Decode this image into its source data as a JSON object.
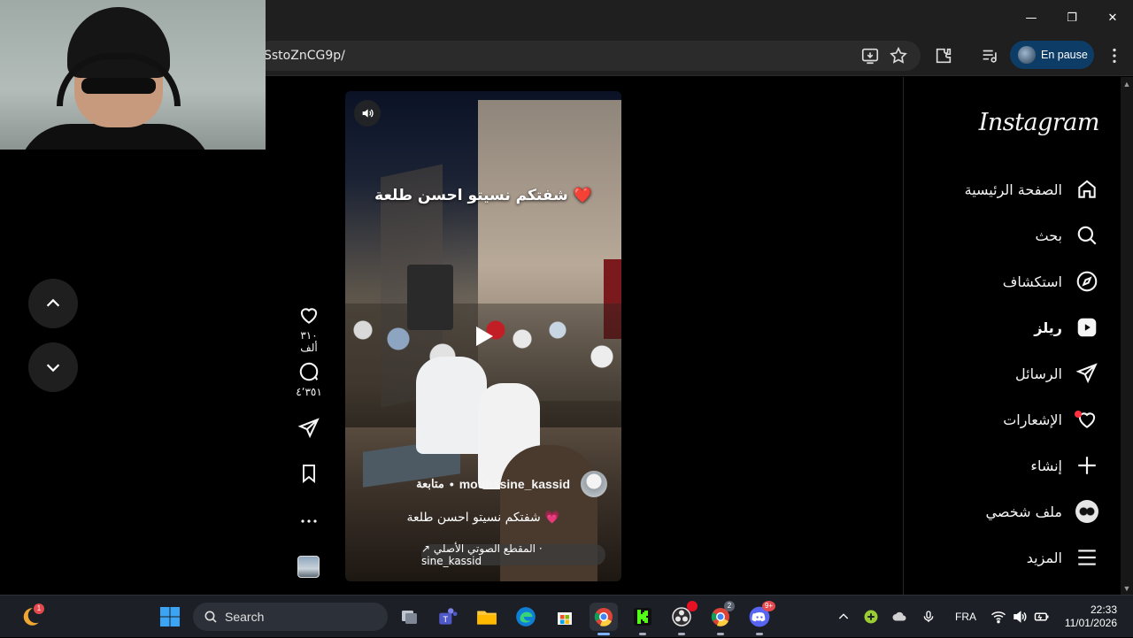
{
  "browser": {
    "url": "SstoZnCG9p/",
    "profile_label": "En pause",
    "controls": {
      "minimize": "—",
      "restore": "❐",
      "close": "✕"
    }
  },
  "reel": {
    "overlay_text": "شفتكم نسيتو احسن طلعة ❤️",
    "author": "mouhssine_kassid",
    "follow_label": "متابعة",
    "separator": "•",
    "caption": "شفتكم نسيتو احسن طلعة 💗",
    "audio": "↗ المقطع الصوتي الأصلي · sine_kassid",
    "likes": "٣١٠ ألف",
    "comments": "٤٬٣٥١",
    "icons": [
      "volume-icon",
      "play-icon",
      "heart-icon",
      "comment-icon",
      "share-icon",
      "bookmark-icon",
      "more-icon"
    ]
  },
  "sidebar": {
    "logo": "Instagram",
    "items": [
      {
        "label": "الصفحة الرئيسية",
        "icon": "home-icon"
      },
      {
        "label": "بحث",
        "icon": "search-icon"
      },
      {
        "label": "استكشاف",
        "icon": "compass-icon"
      },
      {
        "label": "ريلز",
        "icon": "reels-icon"
      },
      {
        "label": "الرسائل",
        "icon": "send-icon"
      },
      {
        "label": "الإشعارات",
        "icon": "heart-icon"
      },
      {
        "label": "إنشاء",
        "icon": "plus-icon"
      },
      {
        "label": "ملف شخصي",
        "icon": "avatar"
      },
      {
        "label": "المزيد",
        "icon": "menu-icon"
      }
    ]
  },
  "taskbar": {
    "search_placeholder": "Search",
    "language": "FRA",
    "time": "22:33",
    "date": "11/01/2026",
    "badges": {
      "weather": "1",
      "obs": "",
      "chrome2": "2",
      "discord": "9+"
    }
  }
}
